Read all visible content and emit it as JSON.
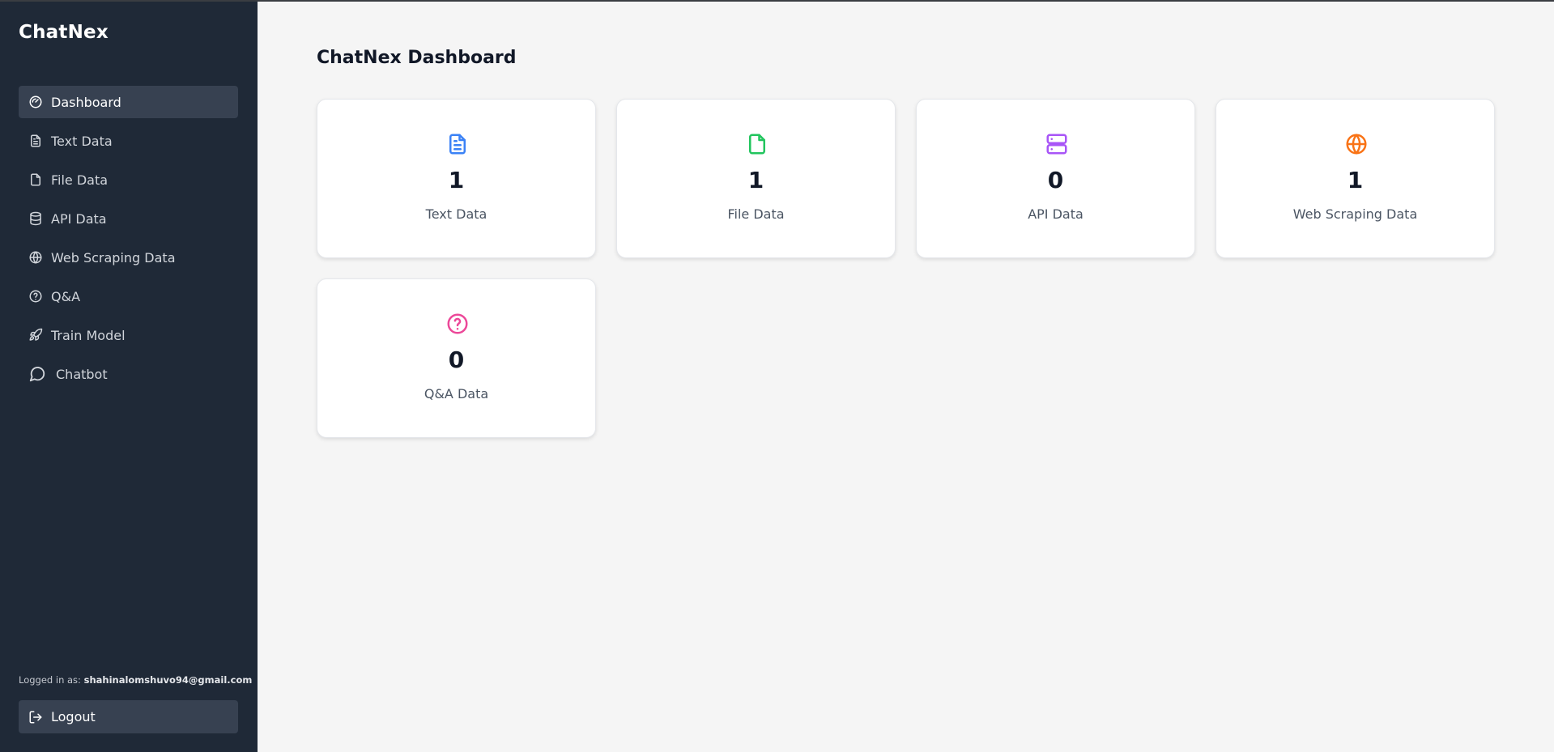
{
  "brand": "ChatNex",
  "nav": [
    {
      "label": "Dashboard",
      "icon": "gauge-icon"
    },
    {
      "label": "Text Data",
      "icon": "file-text-icon"
    },
    {
      "label": "File Data",
      "icon": "file-icon"
    },
    {
      "label": "API Data",
      "icon": "database-icon"
    },
    {
      "label": "Web Scraping Data",
      "icon": "globe-icon"
    },
    {
      "label": "Q&A",
      "icon": "help-circle-icon"
    },
    {
      "label": "Train Model",
      "icon": "rocket-icon"
    },
    {
      "label": "Chatbot",
      "icon": "message-circle-icon"
    }
  ],
  "user": {
    "prefix": "Logged in as:",
    "email": "shahinalomshuvo94@gmail.com"
  },
  "logout_label": "Logout",
  "page_title": "ChatNex Dashboard",
  "cards": [
    {
      "value": "1",
      "label": "Text Data",
      "icon": "file-text-icon",
      "color": "#3b82f6"
    },
    {
      "value": "1",
      "label": "File Data",
      "icon": "file-icon",
      "color": "#22c55e"
    },
    {
      "value": "0",
      "label": "API Data",
      "icon": "server-icon",
      "color": "#a855f7"
    },
    {
      "value": "1",
      "label": "Web Scraping Data",
      "icon": "globe-icon",
      "color": "#f97316"
    },
    {
      "value": "0",
      "label": "Q&A Data",
      "icon": "help-circle-icon",
      "color": "#ec4899"
    }
  ],
  "colors": {
    "sidebar": "#1f2937",
    "active": "#374151",
    "background": "#f5f5f5"
  }
}
